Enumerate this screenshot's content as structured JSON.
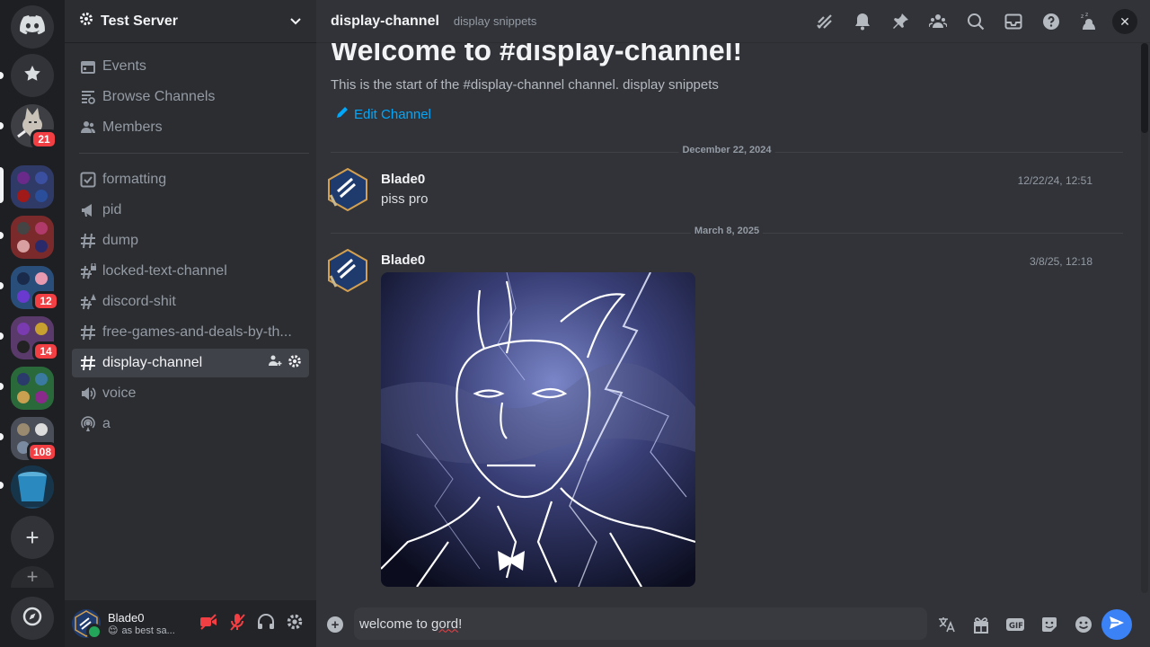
{
  "rail": {
    "badges": [
      "21",
      "12",
      "14",
      "108"
    ]
  },
  "server": {
    "name": "Test Server"
  },
  "sidebar": {
    "top_items": [
      {
        "label": "Events",
        "icon": "calendar-icon"
      },
      {
        "label": "Browse Channels",
        "icon": "browse-channels-icon"
      },
      {
        "label": "Members",
        "icon": "members-icon"
      }
    ],
    "channels": [
      {
        "label": "formatting",
        "icon": "checkbox-icon"
      },
      {
        "label": "pid",
        "icon": "announcement-icon"
      },
      {
        "label": "dump",
        "icon": "hash-icon"
      },
      {
        "label": "locked-text-channel",
        "icon": "hash-lock-icon"
      },
      {
        "label": "discord-shit",
        "icon": "hash-warning-icon"
      },
      {
        "label": "free-games-and-deals-by-th...",
        "icon": "hash-icon"
      },
      {
        "label": "display-channel",
        "icon": "hash-icon",
        "active": true
      },
      {
        "label": "voice",
        "icon": "speaker-icon"
      },
      {
        "label": "a",
        "icon": "stage-icon"
      }
    ]
  },
  "user": {
    "name": "Blade0",
    "status": "as best sa...",
    "status_emoji": "😌"
  },
  "channel": {
    "name": "display-channel",
    "topic": "display snippets",
    "welcome_title": "Welcome to #display-channel!",
    "welcome_sub": "This is the start of the #display-channel channel. display snippets",
    "edit_label": "Edit Channel"
  },
  "messages": [
    {
      "date": "December 22, 2024",
      "author": "Blade0",
      "time": "12/22/24, 12:51",
      "text": "piss pro"
    },
    {
      "date": "March 8, 2025",
      "author": "Blade0",
      "time": "3/8/25, 12:18",
      "text": "",
      "attachment": "lightning-drawing-image"
    }
  ],
  "composer": {
    "value_before": "welcome to ",
    "value_misspelled": "gord",
    "value_after": "!"
  },
  "colors": {
    "accent": "#00a8fc",
    "badge": "#f23f43",
    "online": "#23a55a",
    "send": "#3b82f6"
  }
}
